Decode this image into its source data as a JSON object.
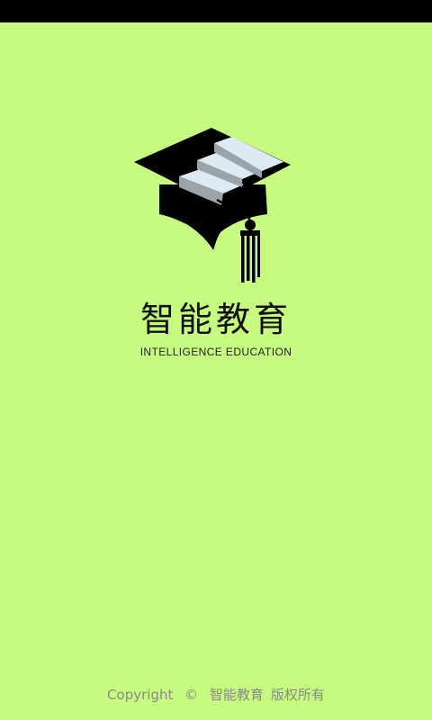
{
  "app": {
    "name": "智能教育",
    "subtitle": "INTELLIGENCE EDUCATION"
  },
  "footer": {
    "copyright_word": "Copyright",
    "copyright_symbol": "©",
    "owner": "智能教育",
    "rights": "版权所有"
  },
  "colors": {
    "background": "#c6fb7f",
    "status_bar": "#000000",
    "text": "#111111",
    "footer_text": "#8a8a8a"
  },
  "icons": {
    "logo": "graduation-cap-icon"
  }
}
